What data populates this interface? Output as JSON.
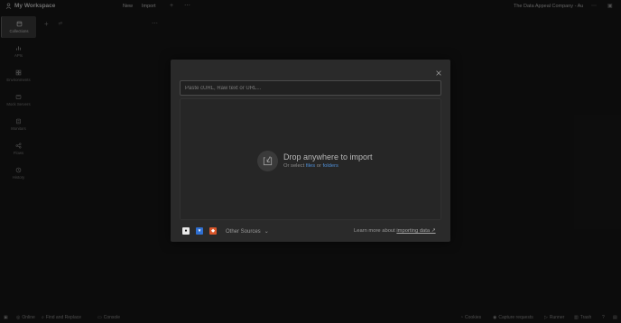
{
  "topbar": {
    "workspace": "My Workspace",
    "new_label": "New",
    "import_label": "Import",
    "team_name": "The Data Appeal Company - Au"
  },
  "rail": {
    "items": [
      {
        "label": "Collections",
        "icon": "collections-icon",
        "active": true
      },
      {
        "label": "APIs",
        "icon": "apis-icon"
      },
      {
        "label": "Environments",
        "icon": "environments-icon"
      },
      {
        "label": "Mock Servers",
        "icon": "mock-servers-icon"
      },
      {
        "label": "Monitors",
        "icon": "monitors-icon"
      },
      {
        "label": "Flows",
        "icon": "flows-icon"
      },
      {
        "label": "History",
        "icon": "history-icon"
      }
    ]
  },
  "modal": {
    "input_placeholder": "Paste cURL, Raw text or URL...",
    "drop_title": "Drop anywhere to import",
    "drop_prefix": "Or select ",
    "files_link": "files",
    "or_word": " or ",
    "folders_link": "folders",
    "other_sources": "Other Sources",
    "learn_prefix": "Learn more about ",
    "learn_link": "importing data ↗",
    "source_icons": [
      "github-icon",
      "bitbucket-icon",
      "gitlab-icon"
    ]
  },
  "status": {
    "online": "Online",
    "find_replace": "Find and Replace",
    "console": "Console",
    "cookies": "Cookies",
    "capture": "Capture requests",
    "runner": "Runner",
    "trash": "Trash"
  },
  "colors": {
    "accent_link": "#4f8fd6",
    "background": "#0e0e0e",
    "modal_bg": "#2a2a2a"
  }
}
